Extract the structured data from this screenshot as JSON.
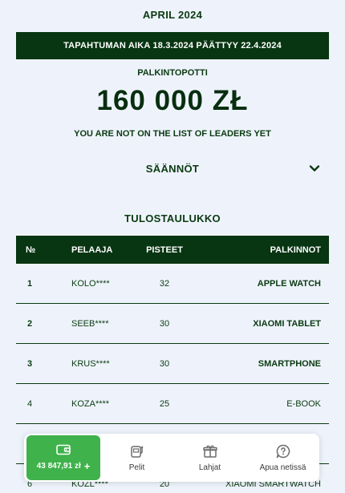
{
  "header": {
    "month": "APRIL 2024",
    "event_dates": "TAPAHTUMAN AIKA 18.3.2024 PÄÄTTYY 22.4.2024",
    "prize_pool_label": "PALKINTOPOTTI",
    "prize_pool_amount": "160 000 ZŁ",
    "not_leader_text": "YOU ARE NOT ON THE LIST OF LEADERS YET"
  },
  "rules": {
    "label": "SÄÄNNÖT"
  },
  "leaderboard": {
    "title": "TULOSTAULUKKO",
    "columns": [
      "№",
      "PELAAJA",
      "PISTEET",
      "PALKINNOT"
    ],
    "rows": [
      {
        "rank": "1",
        "player": "KOLO****",
        "points": "32",
        "prize": "APPLE WATCH"
      },
      {
        "rank": "2",
        "player": "SEEB****",
        "points": "30",
        "prize": "XIAOMI TABLET"
      },
      {
        "rank": "3",
        "player": "KRUS****",
        "points": "30",
        "prize": "SMARTPHONE"
      },
      {
        "rank": "4",
        "player": "KOZA****",
        "points": "25",
        "prize": "E-BOOK"
      },
      {
        "rank": "5",
        "player": "",
        "points": "",
        "prize": ""
      },
      {
        "rank": "6",
        "player": "KOZL****",
        "points": "20",
        "prize": "XIAOMI SMARTWATCH"
      }
    ]
  },
  "bottom_nav": {
    "wallet_balance": "43 847,91 zł",
    "wallet_plus": "+",
    "items": [
      {
        "label": "Pelit",
        "icon": "slot-machine-icon"
      },
      {
        "label": "Lahjat",
        "icon": "gift-icon"
      },
      {
        "label": "Apua netissä",
        "icon": "help-chat-icon"
      }
    ]
  },
  "colors": {
    "dark_green": "#083512",
    "accent_green": "#3fb24b",
    "background": "#eef3fb"
  }
}
